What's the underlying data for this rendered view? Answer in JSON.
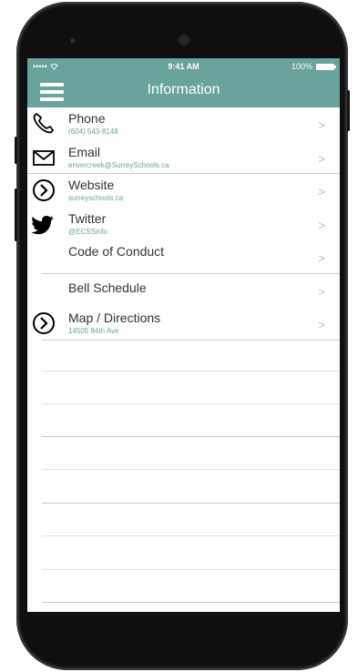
{
  "status_bar": {
    "signal": "•••••",
    "time": "9:41 AM",
    "battery": "100%"
  },
  "nav": {
    "title": "Information"
  },
  "rows": [
    {
      "title": "Phone",
      "subtitle": "(604) 543-8149",
      "icon": "phone-icon"
    },
    {
      "title": "Email",
      "subtitle": "envercreek@SurreySchools.ca",
      "icon": "envelope-icon"
    },
    {
      "title": "Website",
      "subtitle": "surreyschools.ca",
      "icon": "chevron-circle-icon"
    },
    {
      "title": "Twitter",
      "subtitle": "@ECSSinfo",
      "icon": "twitter-bird-icon"
    },
    {
      "title": "Code of Conduct",
      "subtitle": ""
    },
    {
      "title": "Bell Schedule",
      "subtitle": ""
    },
    {
      "title": "Map / Directions",
      "subtitle": "14505 84th Ave",
      "icon": "chevron-circle-icon"
    }
  ],
  "chevron": ">",
  "colors": {
    "accent": "#69a39b",
    "text": "#333333",
    "chevron": "#bdbdbd"
  }
}
